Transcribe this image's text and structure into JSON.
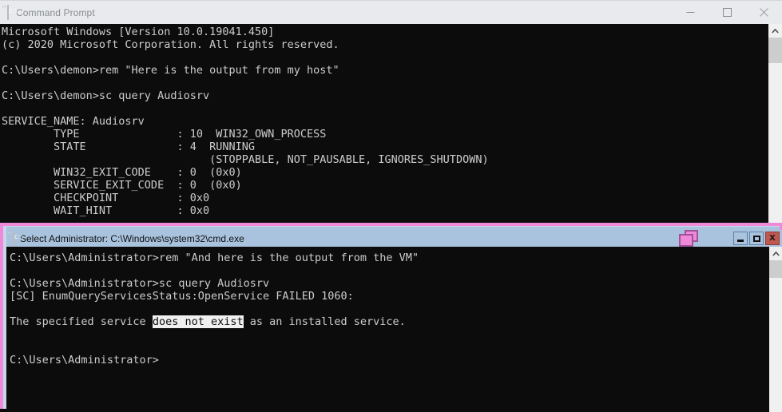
{
  "host_window": {
    "title": "Command Prompt",
    "icon": "cmd-icon",
    "cmd_icon_glyph": "C:\\",
    "state": "inactive",
    "controls": {
      "minimize_label": "Minimize",
      "maximize_label": "Maximize",
      "close_label": "Close"
    },
    "console": {
      "background": "#0c0c0c",
      "foreground": "#cccccc",
      "lines": [
        "Microsoft Windows [Version 10.0.19041.450]",
        "(c) 2020 Microsoft Corporation. All rights reserved.",
        "",
        "C:\\Users\\demon>rem \"Here is the output from my host\"",
        "",
        "C:\\Users\\demon>sc query Audiosrv",
        "",
        "SERVICE_NAME: Audiosrv",
        "        TYPE               : 10  WIN32_OWN_PROCESS",
        "        STATE              : 4  RUNNING",
        "                                (STOPPABLE, NOT_PAUSABLE, IGNORES_SHUTDOWN)",
        "        WIN32_EXIT_CODE    : 0  (0x0)",
        "        SERVICE_EXIT_CODE  : 0  (0x0)",
        "        CHECKPOINT         : 0x0",
        "        WAIT_HINT          : 0x0"
      ]
    },
    "scrollbar": {
      "up_arrow": "chevron-up",
      "thumb_position": "top"
    }
  },
  "vm_window": {
    "title": "Select Administrator: C:\\Windows\\system32\\cmd.exe",
    "icon": "cmd-icon",
    "cmd_icon_glyph": "C:\\",
    "state": "active",
    "border_color": "#f08ad8",
    "titlebar_color": "#a9c3de",
    "close_button_color": "#c0584f",
    "cascade_icon": "cascade-windows-icon",
    "controls": {
      "minimize_label": "Minimize",
      "maximize_label": "Maximize",
      "close_label": "X"
    },
    "console": {
      "background": "#0c0c0c",
      "foreground": "#cccccc",
      "selection_background": "#f0f0f0",
      "selection_foreground": "#0c0c0c",
      "lines_before_selection": [
        "C:\\Users\\Administrator>rem \"And here is the output from the VM\"",
        "",
        "C:\\Users\\Administrator>sc query Audiosrv",
        "[SC] EnumQueryServicesStatus:OpenService FAILED 1060:",
        ""
      ],
      "selection_line": {
        "prefix": "The specified service ",
        "selected": "does not exist",
        "suffix": " as an installed service."
      },
      "lines_after_selection": [
        "",
        "",
        "C:\\Users\\Administrator>"
      ]
    },
    "scrollbar": {
      "up_arrow": "chevron-up",
      "thumb_position": "top"
    }
  }
}
